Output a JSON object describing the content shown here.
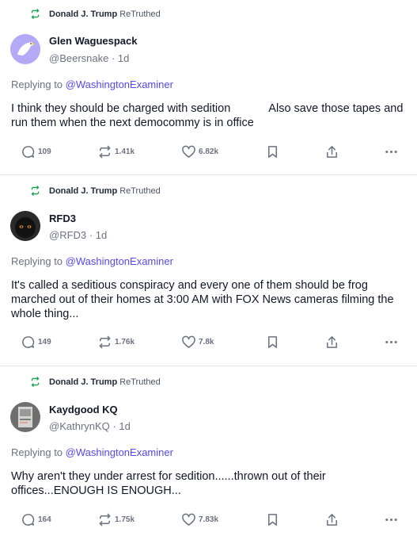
{
  "posts": [
    {
      "retruth_by": "Donald J. Trump",
      "retruth_label": "ReTruthed",
      "author": "Glen Waguespack",
      "handle": "@Beersnake",
      "age": "1d",
      "replying_prefix": "Replying to",
      "replying_to": "@WashingtonExaminer",
      "text_a": "I think they should be charged with sedition",
      "text_b": "Also save those tapes and run them when the next democommy is in office",
      "replies": "109",
      "retruths": "1.41k",
      "likes": "6.82k",
      "avatar": "eagle-avatar"
    },
    {
      "retruth_by": "Donald J. Trump",
      "retruth_label": "ReTruthed",
      "author": "RFD3",
      "handle": "@RFD3",
      "age": "1d",
      "replying_prefix": "Replying to",
      "replying_to": "@WashingtonExaminer",
      "text": "It's called a seditious conspiracy and every one of them should be frog marched out of their homes at 3:00 AM with FOX News cameras filming the whole thing...",
      "replies": "149",
      "retruths": "1.76k",
      "likes": "7.8k",
      "avatar": "black-cat-avatar"
    },
    {
      "retruth_by": "Donald J. Trump",
      "retruth_label": "ReTruthed",
      "author": "Kaydgood KQ",
      "handle": "@KathrynKQ",
      "age": "1d",
      "replying_prefix": "Replying to",
      "replying_to": "@WashingtonExaminer",
      "text": "Why aren't they under arrest for sedition......thrown out of their offices...ENOUGH IS ENOUGH...",
      "replies": "164",
      "retruths": "1.75k",
      "likes": "7.83k",
      "avatar": "photo-avatar"
    }
  ],
  "colors": {
    "accent": "#5448ee",
    "retruth_green": "#17a34a",
    "muted": "#6b7280",
    "divider": "#e5e7eb"
  },
  "icons": [
    "retruth-icon",
    "reply-icon",
    "heart-icon",
    "bookmark-icon",
    "share-icon",
    "more-icon"
  ]
}
